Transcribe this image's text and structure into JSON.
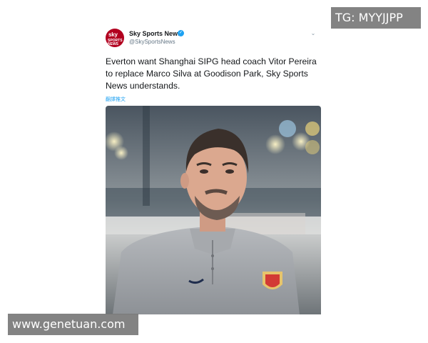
{
  "tweet": {
    "account": {
      "display_name": "Sky Sports News",
      "handle": "@SkySportsNews",
      "avatar_text": [
        "sky",
        "SPORTS",
        "NEWS"
      ]
    },
    "text": "Everton want Shanghai SIPG head coach Vitor Pereira to replace Marco Silva at Goodison Park, Sky Sports News understands.",
    "translate_label": "翻譯推文",
    "media": "photo-of-coach-icon"
  },
  "watermarks": {
    "top_right": "TG: MYYJJPP",
    "bottom_left": "www.genetuan.com"
  },
  "colors": {
    "accent": "#1da1f2",
    "brand": "#b2001f",
    "watermark_bg": "#787878"
  }
}
